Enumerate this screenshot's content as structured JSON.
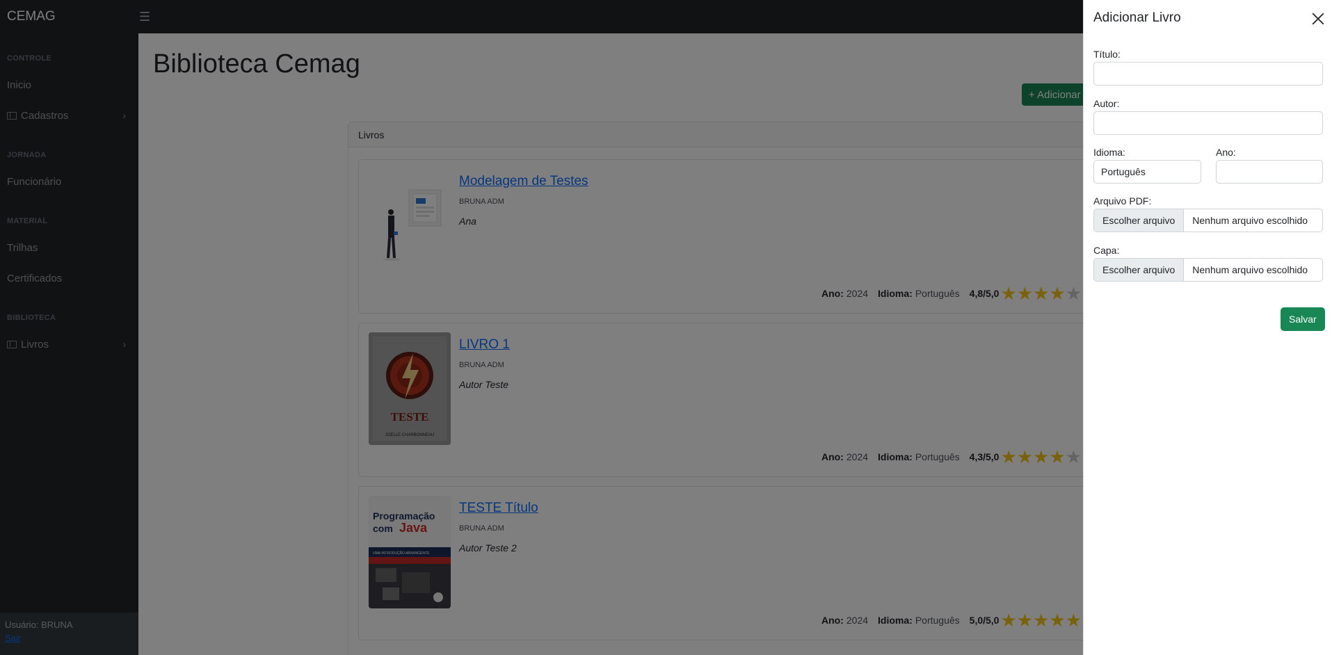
{
  "navbar": {
    "brand": "CEMAG",
    "toggle_icon": "☰"
  },
  "sidebar": {
    "sections": [
      {
        "heading": "CONTROLE"
      },
      {
        "heading": "JORNADA"
      },
      {
        "heading": "MATERIAL"
      },
      {
        "heading": "BIBLIOTECA"
      }
    ],
    "items": [
      {
        "label": "Inicio"
      },
      {
        "label": "Cadastros",
        "icon": "table-icon",
        "has_submenu": true
      },
      {
        "label": "Funcionário"
      },
      {
        "label": "Trilhas"
      },
      {
        "label": "Certificados"
      },
      {
        "label": "Livros",
        "icon": "table-icon",
        "has_submenu": true
      }
    ],
    "footer": {
      "user": "Usuário: BRUNA",
      "logout": "Sair"
    }
  },
  "main": {
    "title": "Biblioteca Cemag",
    "add_button": "+ Adicionar",
    "card_header": "Livros",
    "books": [
      {
        "title": "Modelagem de Testes",
        "owner": "BRUNA ADM",
        "author": "Ana",
        "year_label": "Ano:",
        "year": "2024",
        "language_label": "Idioma:",
        "language": "Português",
        "rating_text": "4,8/5,0",
        "stars_filled": 4,
        "stars_total": 5
      },
      {
        "title": "LIVRO 1",
        "owner": "BRUNA ADM",
        "author": "Autor Teste",
        "year_label": "Ano:",
        "year": "2024",
        "language_label": "Idioma:",
        "language": "Português",
        "rating_text": "4,3/5,0",
        "stars_filled": 4,
        "stars_total": 5
      },
      {
        "title": "TESTE Título",
        "owner": "BRUNA ADM",
        "author": "Autor Teste 2",
        "year_label": "Ano:",
        "year": "2024",
        "language_label": "Idioma:",
        "language": "Português",
        "rating_text": "5,0/5,0",
        "stars_filled": 5,
        "stars_total": 5
      }
    ],
    "cover_texts": {
      "book2_big": "TESTE",
      "book2_author": "JOELLE CHARBONNEAU",
      "book3_line1": "Programação",
      "book3_line2": "com",
      "book3_java": "Java",
      "book3_sub": "UMA INTRODUÇÃO ABRANGENTE"
    }
  },
  "offcanvas": {
    "title": "Adicionar Livro",
    "fields": {
      "titulo_label": "Título:",
      "titulo_value": "",
      "autor_label": "Autor:",
      "autor_value": "",
      "idioma_label": "Idioma:",
      "idioma_value": "Português",
      "ano_label": "Ano:",
      "ano_value": "",
      "pdf_label": "Arquivo PDF:",
      "capa_label": "Capa:",
      "file_button": "Escolher arquivo",
      "file_none": "Nenhum arquivo escolhido"
    },
    "save_button": "Salvar"
  },
  "colors": {
    "sidebar_bg": "#212529",
    "primary_link": "#0d6efd",
    "success": "#198754",
    "star": "#f5c518",
    "overlay": "rgba(0,0,0,0.5)"
  }
}
